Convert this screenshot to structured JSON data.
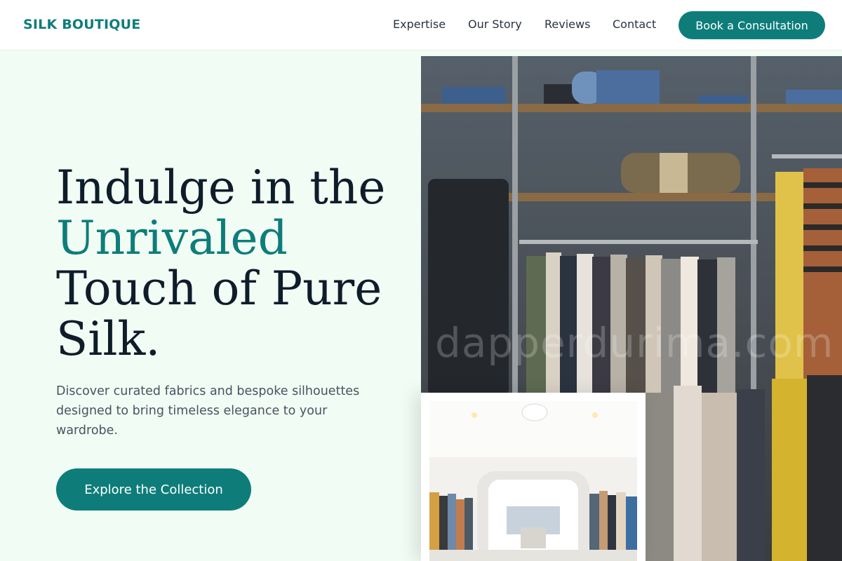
{
  "header": {
    "logo": "SILK BOUTIQUE",
    "nav": [
      "Expertise",
      "Our Story",
      "Reviews",
      "Contact"
    ],
    "cta": "Book a Consultation"
  },
  "hero": {
    "headline_line1": "Indulge in the",
    "headline_accent": "Unrivaled",
    "headline_line3": "Touch of Pure",
    "headline_line4": "Silk.",
    "intro": "Discover curated fabrics and bespoke silhouettes designed to bring timeless elegance to your wardrobe.",
    "cta": "Explore the Collection"
  },
  "images": {
    "main_watermark": "dapperdurima.com"
  },
  "colors": {
    "brand": "#0e7d7a",
    "text_dark": "#0f1c2a",
    "background": "#f1fcf4"
  }
}
